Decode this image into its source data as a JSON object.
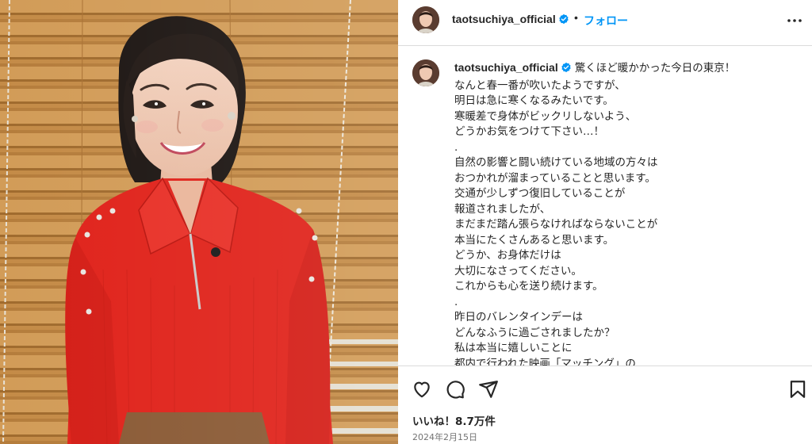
{
  "post": {
    "username": "taotsuchiya_official",
    "separator": "•",
    "follow_label": "フォロー",
    "caption_lines": [
      "驚くほど暖かかった今日の東京！",
      "なんと春一番が吹いたようですが、",
      "明日は急に寒くなるみたいです。",
      "寒暖差で身体がビックリしないよう、",
      "どうかお気をつけて下さい…！",
      ".",
      "自然の影響と闘い続けている地域の方々は",
      "おつかれが溜まっていることと思います。",
      "交通が少しずつ復旧していることが",
      "報道されましたが、",
      "まだまだ踏ん張らなければならないことが",
      "本当にたくさんあると思います。",
      "どうか、お身体だけは",
      "大切になさってください。",
      "これからも心を送り続けます。",
      ".",
      "昨日のバレンタインデーは",
      "どんなふうに過ごされましたか？",
      "私は本当に嬉しいことに",
      "都内で行われた映画「マッチング」の"
    ],
    "likes": "いいね！8.7万件",
    "date": "2024年2月15日"
  },
  "icons": {
    "more": "more-options-icon",
    "verified": "verified-badge-icon",
    "like": "heart-icon",
    "comment": "comment-icon",
    "share": "share-icon",
    "save": "bookmark-icon"
  },
  "colors": {
    "link_blue": "#0095f6",
    "verified_blue": "#0095f6",
    "text": "#262626",
    "muted": "#737373",
    "divider": "#dbdbdb",
    "sweater_red": "#e0231b"
  }
}
